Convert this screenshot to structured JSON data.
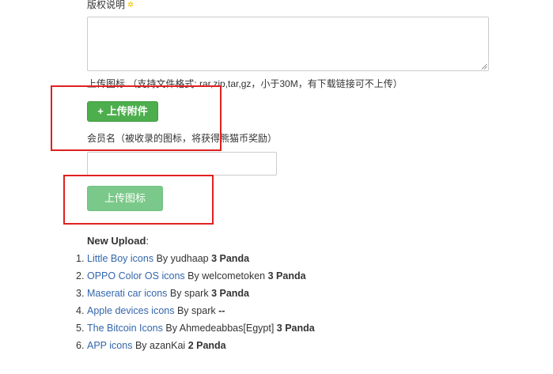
{
  "form": {
    "copyright_label": "版权说明",
    "required_mark": "✲",
    "copyright_value": "",
    "upload_hint": "上传图标 （支持文件格式: rar,zip,tar,gz，小于30M，有下载链接可不上传）",
    "attach_button": {
      "icon": "plus-icon",
      "plus": "+",
      "label": "上传附件"
    },
    "member_label": "会员名（被收录的图标，将获得熊猫币奖励）",
    "member_value": "",
    "submit_button": "上传图标"
  },
  "new_upload": {
    "title": "New Upload",
    "colon": ":",
    "items": [
      {
        "num": "1.",
        "name": "Little Boy icons",
        "by": "By",
        "author": "yudhaap",
        "reward": "3 Panda"
      },
      {
        "num": "2.",
        "name": "OPPO Color OS icons",
        "by": "By",
        "author": "welcometoken",
        "reward": "3 Panda"
      },
      {
        "num": "3.",
        "name": "Maserati car icons",
        "by": "By",
        "author": "spark",
        "reward": "3 Panda"
      },
      {
        "num": "4.",
        "name": "Apple devices icons",
        "by": "By",
        "author": "spark",
        "reward": "--"
      },
      {
        "num": "5.",
        "name": "The Bitcoin Icons",
        "by": "By",
        "author": "Ahmedeabbas[Egypt]",
        "reward": "3 Panda"
      },
      {
        "num": "6.",
        "name": "APP icons",
        "by": "By",
        "author": "azanKai",
        "reward": "2 Panda"
      }
    ]
  },
  "colors": {
    "link": "#3366aa",
    "attach_button": "#4cae4c",
    "submit_button": "#7bc98a",
    "highlight": "#e02020"
  }
}
